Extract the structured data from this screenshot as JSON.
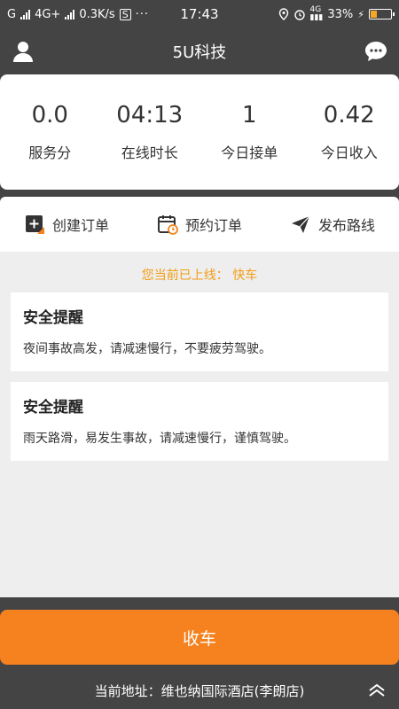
{
  "status_bar": {
    "carrier1": "G",
    "network": "4G+",
    "speed": "0.3K/s",
    "time": "17:43",
    "battery_text": "33%",
    "battery_level": 0.33
  },
  "header": {
    "title": "5U科技"
  },
  "stats": [
    {
      "value": "0.0",
      "label": "服务分"
    },
    {
      "value": "04:13",
      "label": "在线时长"
    },
    {
      "value": "1",
      "label": "今日接单"
    },
    {
      "value": "0.42",
      "label": "今日收入"
    }
  ],
  "actions": [
    {
      "label": "创建订单",
      "icon": "create-order-icon"
    },
    {
      "label": "预约订单",
      "icon": "calendar-icon"
    },
    {
      "label": "发布路线",
      "icon": "send-icon"
    }
  ],
  "online_status": "您当前已上线： 快车",
  "notices": [
    {
      "title": "安全提醒",
      "text": "夜间事故高发，请减速慢行，不要疲劳驾驶。"
    },
    {
      "title": "安全提醒",
      "text": "雨天路滑，易发生事故，请减速慢行，谨慎驾驶。"
    }
  ],
  "finish_button": "收车",
  "address": "当前地址：维也纳国际酒店(李朗店)",
  "colors": {
    "accent": "#f5821f",
    "status_text": "#f39c12",
    "dark_bg": "#444444"
  }
}
